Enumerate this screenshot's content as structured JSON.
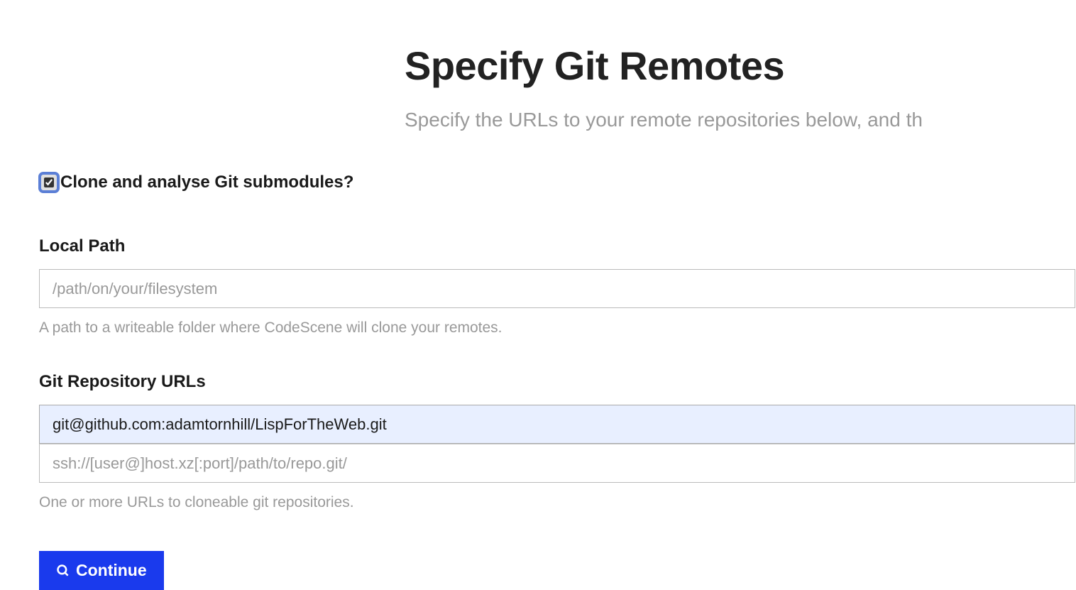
{
  "header": {
    "title": "Specify Git Remotes",
    "subtitle": "Specify the URLs to your remote repositories below, and th"
  },
  "checkbox": {
    "label": "Clone and analyse Git submodules?",
    "checked": true
  },
  "localPath": {
    "label": "Local Path",
    "placeholder": "/path/on/your/filesystem",
    "value": "",
    "help": "A path to a writeable folder where CodeScene will clone your remotes."
  },
  "repoUrls": {
    "label": "Git Repository URLs",
    "entries": [
      {
        "value": "git@github.com:adamtornhill/LispForTheWeb.git"
      }
    ],
    "nextPlaceholder": "ssh://[user@]host.xz[:port]/path/to/repo.git/",
    "help": "One or more URLs to cloneable git repositories."
  },
  "continue": {
    "label": "Continue"
  }
}
